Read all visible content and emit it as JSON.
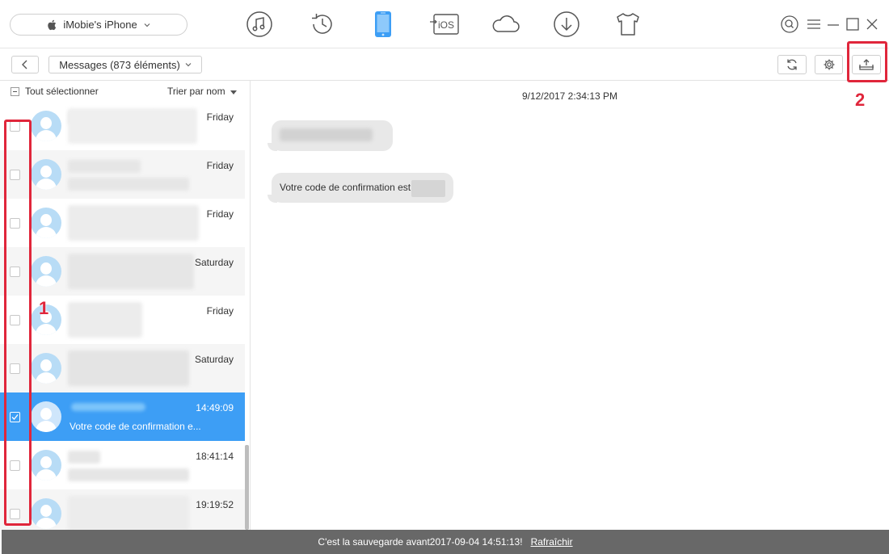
{
  "header": {
    "device_name": "iMobie's iPhone",
    "nav_icons": [
      "music-icon",
      "history-icon",
      "phone-icon",
      "ios-transfer-icon",
      "cloud-icon",
      "download-icon",
      "tshirt-icon"
    ],
    "ios_label": "iOS",
    "accent_color": "#3d9ef5"
  },
  "toolbar": {
    "category_label": "Messages (873 éléments)"
  },
  "list": {
    "select_all_label": "Tout sélectionner",
    "sort_label": "Trier par nom",
    "rows": [
      {
        "time": "Friday",
        "selected": false,
        "preview": ""
      },
      {
        "time": "Friday",
        "selected": false,
        "preview": ""
      },
      {
        "time": "Friday",
        "selected": false,
        "preview": ""
      },
      {
        "time": "Saturday",
        "selected": false,
        "preview": ""
      },
      {
        "time": "Friday",
        "selected": false,
        "preview": ""
      },
      {
        "time": "Saturday",
        "selected": false,
        "preview": ""
      },
      {
        "time": "14:49:09",
        "selected": true,
        "preview": "Votre code de confirmation e..."
      },
      {
        "time": "18:41:14",
        "selected": false,
        "preview": ""
      },
      {
        "time": "19:19:52",
        "selected": false,
        "preview": ""
      }
    ]
  },
  "conversation": {
    "date": "9/12/2017 2:34:13 PM",
    "message_2": "Votre code de confirmation est"
  },
  "annotations": {
    "label_1": "1",
    "label_2": "2",
    "color": "#e0263b"
  },
  "footer": {
    "text": "C'est la sauvegarde avant2017-09-04 14:51:13!",
    "link": "Rafraîchir"
  }
}
